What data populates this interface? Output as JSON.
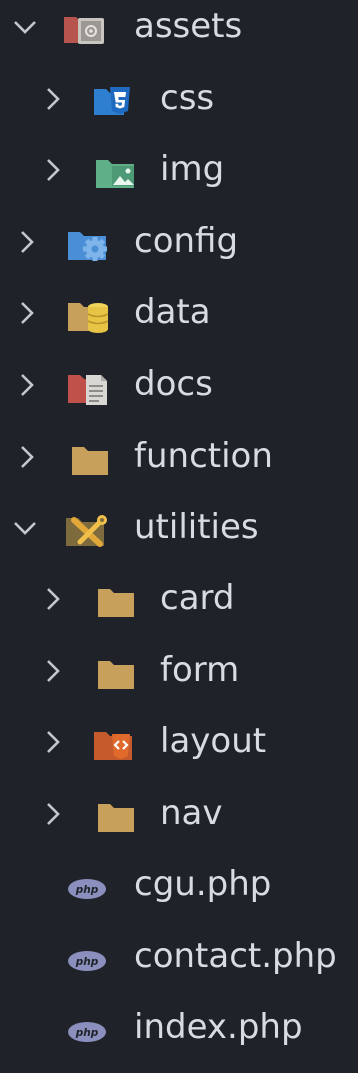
{
  "explorer": {
    "items": [
      {
        "label": "assets",
        "kind": "folder",
        "state": "expanded",
        "icon": "assets-folder-icon"
      },
      {
        "label": "css",
        "kind": "folder",
        "state": "collapsed",
        "icon": "css-folder-icon"
      },
      {
        "label": "img",
        "kind": "folder",
        "state": "collapsed",
        "icon": "images-folder-icon"
      },
      {
        "label": "config",
        "kind": "folder",
        "state": "collapsed",
        "icon": "config-folder-icon"
      },
      {
        "label": "data",
        "kind": "folder",
        "state": "collapsed",
        "icon": "database-folder-icon"
      },
      {
        "label": "docs",
        "kind": "folder",
        "state": "collapsed",
        "icon": "docs-folder-icon"
      },
      {
        "label": "function",
        "kind": "folder",
        "state": "collapsed",
        "icon": "folder-icon"
      },
      {
        "label": "utilities",
        "kind": "folder",
        "state": "expanded",
        "icon": "utilities-folder-icon"
      },
      {
        "label": "card",
        "kind": "folder",
        "state": "collapsed",
        "icon": "folder-icon"
      },
      {
        "label": "form",
        "kind": "folder",
        "state": "collapsed",
        "icon": "folder-icon"
      },
      {
        "label": "layout",
        "kind": "folder",
        "state": "collapsed",
        "icon": "layout-folder-icon"
      },
      {
        "label": "nav",
        "kind": "folder",
        "state": "collapsed",
        "icon": "folder-icon"
      },
      {
        "label": "cgu.php",
        "kind": "file",
        "icon": "php-file-icon"
      },
      {
        "label": "contact.php",
        "kind": "file",
        "icon": "php-file-icon"
      },
      {
        "label": "index.php",
        "kind": "file",
        "icon": "php-file-icon"
      }
    ],
    "icon_text": {
      "php": "php"
    }
  },
  "colors": {
    "background": "#1f2329",
    "text": "#d7dbe2",
    "chevron": "#c3c7cf",
    "folder_tan": "#c7a05c",
    "css_blue": "#2f7fd0",
    "img_green": "#5fb089",
    "config_blue": "#4a8fd6",
    "data_yellow": "#e7c446",
    "docs_red": "#c0504a",
    "layout_orange": "#d9612f",
    "php_purple": "#8a8fbd"
  }
}
